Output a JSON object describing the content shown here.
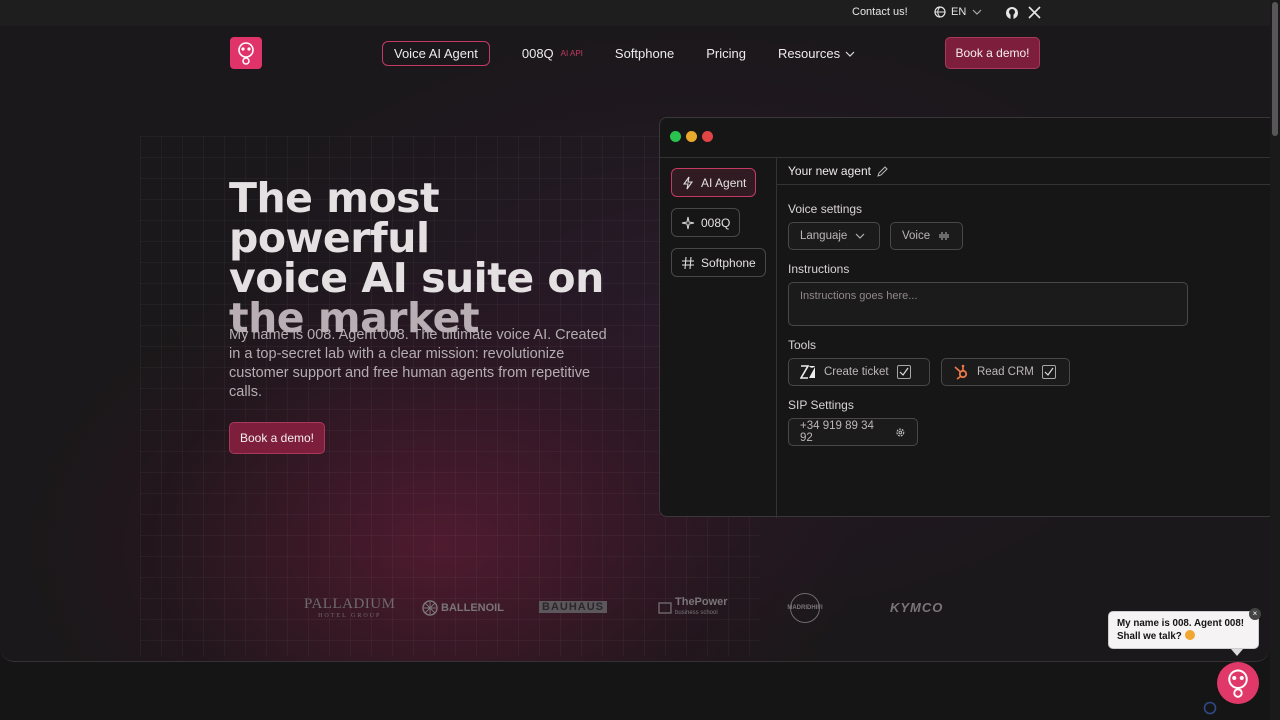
{
  "topbar": {
    "contact": "Contact us!",
    "lang": "EN"
  },
  "nav": {
    "items": [
      {
        "label": "Voice AI Agent"
      },
      {
        "label": "008Q",
        "sup": "AI API"
      },
      {
        "label": "Softphone"
      },
      {
        "label": "Pricing"
      },
      {
        "label": "Resources"
      }
    ],
    "cta": "Book a demo!"
  },
  "hero": {
    "headline_line1": "The most powerful",
    "headline_line2": "voice AI suite on",
    "headline_line3": "the market",
    "description": "My name is 008. Agent 008. The ultimate voice AI. Created in a top-secret lab with a clear mission: revolutionize customer support and free human agents from repetitive calls.",
    "cta": "Book a demo!"
  },
  "window": {
    "sidebar": [
      {
        "label": "AI Agent",
        "icon": "lightning-icon"
      },
      {
        "label": "008Q",
        "icon": "sparkle-icon"
      },
      {
        "label": "Softphone",
        "icon": "hash-icon"
      }
    ],
    "agent_title": "Your new agent",
    "voice_settings_label": "Voice settings",
    "language_select": "Languaje",
    "voice_select": "Voice",
    "instructions_label": "Instructions",
    "instructions_placeholder": "Instructions goes here...",
    "tools_label": "Tools",
    "tools": [
      {
        "label": "Create ticket",
        "icon": "zendesk-icon"
      },
      {
        "label": "Read CRM",
        "icon": "hubspot-icon"
      }
    ],
    "sip_label": "SIP Settings",
    "sip_number": "+34 919 89 34 92"
  },
  "logos": [
    "PALLADIUM",
    "BALLENOIL",
    "BAUHAUS",
    "ThePower",
    "MADRIDHIFI",
    "KYMCO"
  ],
  "logo_subtexts": {
    "palladium": "HOTEL GROUP",
    "thepower": "business school"
  },
  "chat": {
    "line1": "My name is 008. Agent 008!",
    "line2": "Shall we talk?",
    "close": "×"
  },
  "colors": {
    "accent": "#c43a63",
    "brand_pink": "#e0336a",
    "cta_bg": "#7d1f3c"
  }
}
